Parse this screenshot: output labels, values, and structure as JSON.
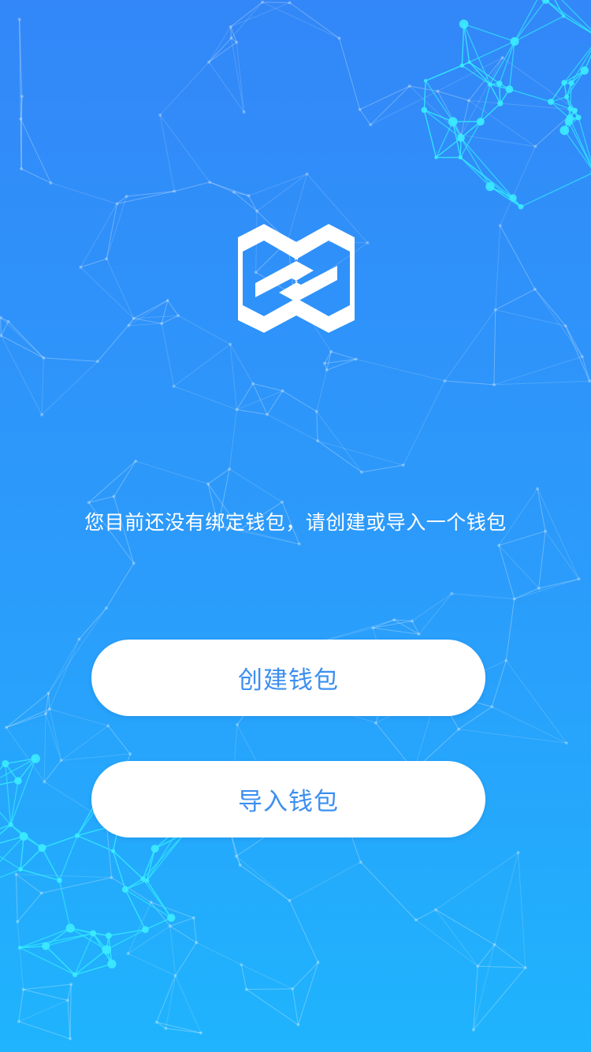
{
  "colors": {
    "background_top": "#3387f8",
    "background_bottom": "#1fb4fd",
    "button_background": "#ffffff",
    "button_text": "#3c8ff0",
    "message_text": "#ffffff",
    "logo": "#ffffff"
  },
  "logo": {
    "icon": "linked-chain-logo-icon"
  },
  "message": "您目前还没有绑定钱包，请创建或导入一个钱包",
  "actions": {
    "create_wallet": "创建钱包",
    "import_wallet": "导入钱包"
  }
}
